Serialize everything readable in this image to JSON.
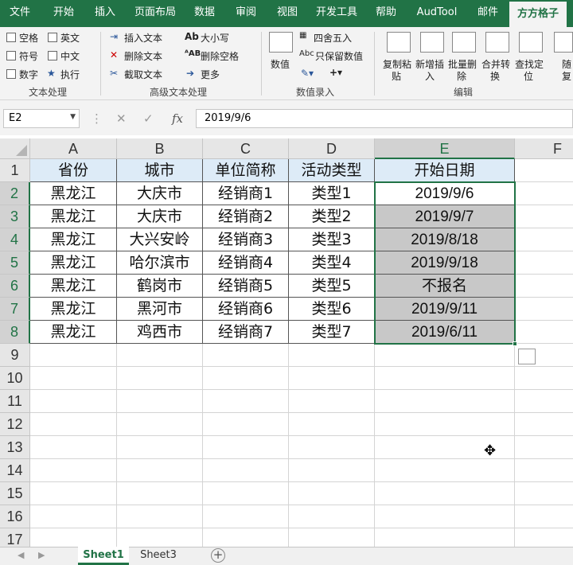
{
  "tabs": [
    "文件",
    "开始",
    "插入",
    "页面布局",
    "数据",
    "审阅",
    "视图",
    "开发工具",
    "帮助",
    "AudTool",
    "邮件",
    "方方格子"
  ],
  "ribbon": {
    "text_group": {
      "checkboxes": [
        "空格",
        "英文",
        "符号",
        "中文",
        "数字"
      ],
      "execute": "执行",
      "label": "文本处理"
    },
    "advanced_group": {
      "insert_text": "插入文本",
      "delete_text": "删除文本",
      "cut_text": "截取文本",
      "case": "大小写",
      "delete_space": "删除空格",
      "more": "更多",
      "label": "高级文本处理"
    },
    "entry_group": {
      "number": "数值",
      "round": "四舍五入",
      "keep_value": "只保留数值",
      "label": "数值录入"
    },
    "edit_group": {
      "buttons": [
        {
          "line1": "复制粘",
          "line2": "贴"
        },
        {
          "line1": "新增插",
          "line2": "入"
        },
        {
          "line1": "批量删",
          "line2": "除"
        },
        {
          "line1": "合并转",
          "line2": "换"
        },
        {
          "line1": "查找定",
          "line2": "位"
        },
        {
          "line1": "随",
          "line2": "复"
        }
      ],
      "label": "编辑"
    }
  },
  "formula_bar": {
    "name_box": "E2",
    "fx": "fx",
    "value": "2019/9/6"
  },
  "columns": [
    "A",
    "B",
    "C",
    "D",
    "E",
    "F"
  ],
  "rows": [
    "1",
    "2",
    "3",
    "4",
    "5",
    "6",
    "7",
    "8",
    "9",
    "10",
    "11",
    "12",
    "13",
    "14",
    "15",
    "16",
    "17"
  ],
  "table": {
    "headers": [
      "省份",
      "城市",
      "单位简称",
      "活动类型",
      "开始日期"
    ],
    "rows": [
      [
        "黑龙江",
        "大庆市",
        "经销商1",
        "类型1",
        "2019/9/6"
      ],
      [
        "黑龙江",
        "大庆市",
        "经销商2",
        "类型2",
        "2019/9/7"
      ],
      [
        "黑龙江",
        "大兴安岭",
        "经销商3",
        "类型3",
        "2019/8/18"
      ],
      [
        "黑龙江",
        "哈尔滨市",
        "经销商4",
        "类型4",
        "2019/9/18"
      ],
      [
        "黑龙江",
        "鹤岗市",
        "经销商5",
        "类型5",
        "不报名"
      ],
      [
        "黑龙江",
        "黑河市",
        "经销商6",
        "类型6",
        "2019/9/11"
      ],
      [
        "黑龙江",
        "鸡西市",
        "经销商7",
        "类型7",
        "2019/6/11"
      ]
    ]
  },
  "sheets": [
    "Sheet1",
    "Sheet3"
  ],
  "colors": {
    "accent": "#217346",
    "header_fill": "#ddebf7",
    "selection_fill": "#c8c8c8"
  }
}
